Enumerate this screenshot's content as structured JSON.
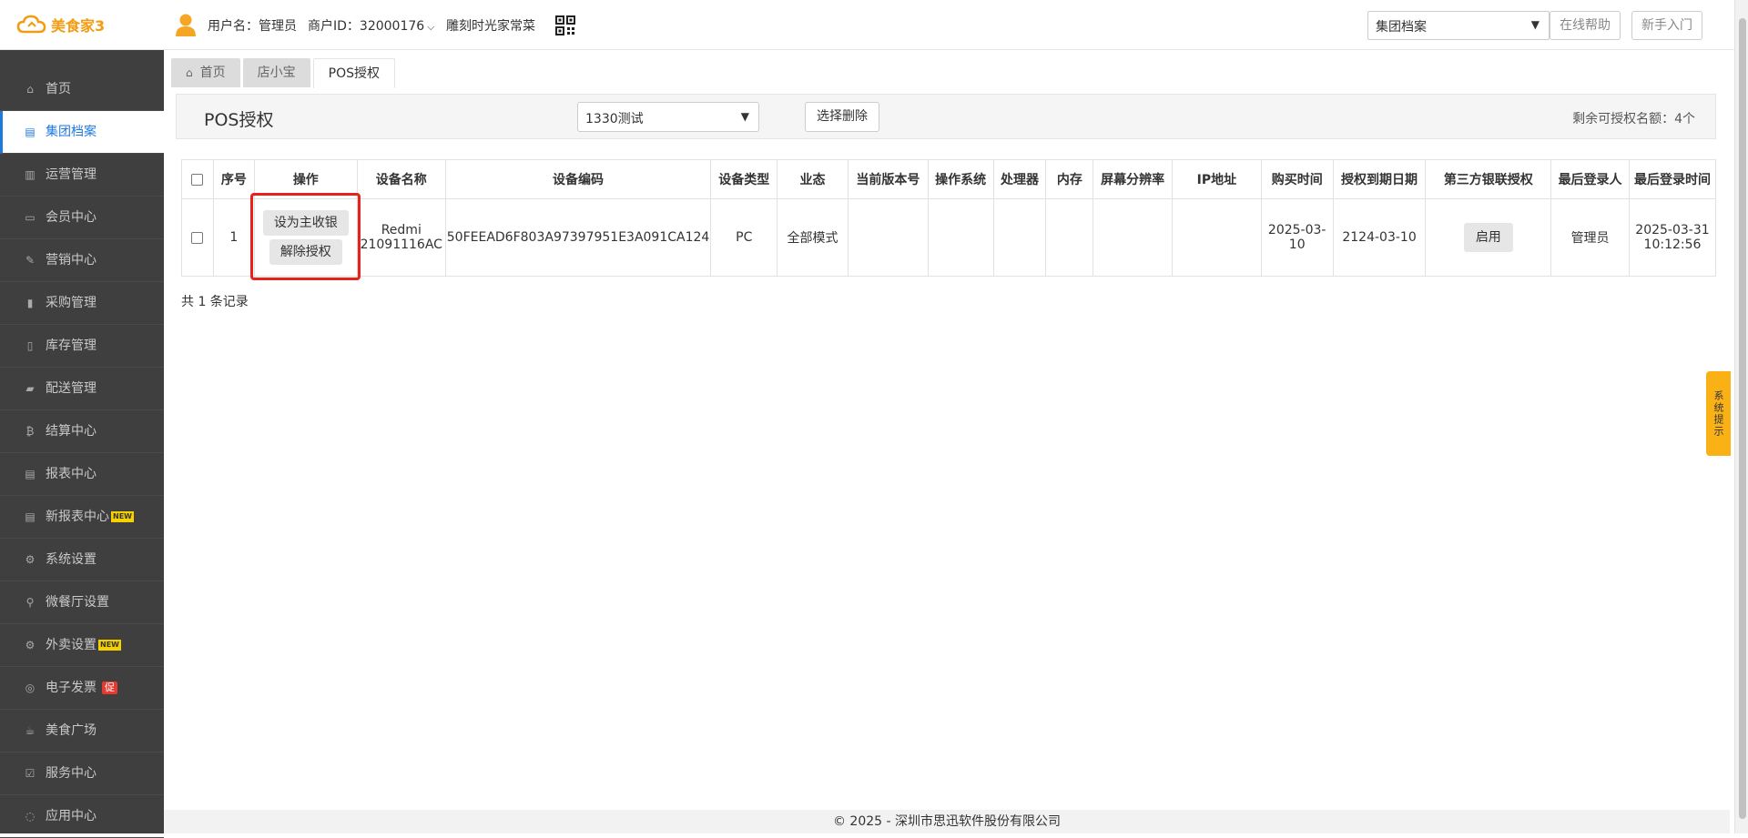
{
  "header": {
    "logo_text": "美食家3",
    "username": "用户名：管理员",
    "merchant_id": "商户ID：32000176",
    "merchant_chevron": "⌵",
    "brand": "雕刻时光家常菜",
    "group_select": "集团档案",
    "help_button": "在线帮助",
    "newbie_button": "新手入门"
  },
  "sidebar": {
    "items": [
      {
        "label": "首页",
        "icon": "home-icon",
        "glyph": "⌂"
      },
      {
        "label": "集团档案",
        "icon": "file-icon",
        "glyph": "▤"
      },
      {
        "label": "运营管理",
        "icon": "chart-icon",
        "glyph": "▥"
      },
      {
        "label": "会员中心",
        "icon": "id-card-icon",
        "glyph": "▭"
      },
      {
        "label": "营销中心",
        "icon": "edit-icon",
        "glyph": "✎"
      },
      {
        "label": "采购管理",
        "icon": "book-icon",
        "glyph": "▮"
      },
      {
        "label": "库存管理",
        "icon": "box-icon",
        "glyph": "▯"
      },
      {
        "label": "配送管理",
        "icon": "truck-icon",
        "glyph": "▰"
      },
      {
        "label": "结算中心",
        "icon": "bitcoin-icon",
        "glyph": "₿"
      },
      {
        "label": "报表中心",
        "icon": "report-icon",
        "glyph": "▤"
      },
      {
        "label": "新报表中心",
        "icon": "report-icon",
        "glyph": "▤",
        "badge": "NEW"
      },
      {
        "label": "系统设置",
        "icon": "cogs-icon",
        "glyph": "⚙"
      },
      {
        "label": "微餐厅设置",
        "icon": "cutlery-icon",
        "glyph": "⚲"
      },
      {
        "label": "外卖设置",
        "icon": "gear-icon",
        "glyph": "⚙",
        "badge": "NEW"
      },
      {
        "label": "电子发票",
        "icon": "invoice-icon",
        "glyph": "◎",
        "promo": "促"
      },
      {
        "label": "美食广场",
        "icon": "food-icon",
        "glyph": "☕"
      },
      {
        "label": "服务中心",
        "icon": "service-icon",
        "glyph": "☑"
      },
      {
        "label": "应用中心",
        "icon": "app-icon",
        "glyph": "◌"
      }
    ]
  },
  "tabs": [
    {
      "label": "首页",
      "icon": "home-icon",
      "glyph": "⌂"
    },
    {
      "label": "店小宝"
    },
    {
      "label": "POS授权"
    }
  ],
  "toolbar": {
    "title": "POS授权",
    "store_select": "1330测试",
    "delete_button": "选择删除",
    "quota": "剩余可授权名额：4个"
  },
  "table": {
    "headers": [
      "序号",
      "操作",
      "设备名称",
      "设备编码",
      "设备类型",
      "业态",
      "当前版本号",
      "操作系统",
      "处理器",
      "内存",
      "屏幕分辨率",
      "IP地址",
      "购买时间",
      "授权到期日期",
      "第三方银联授权",
      "最后登录人",
      "最后登录时间"
    ],
    "rows": [
      {
        "index": "1",
        "op_set_main": "设为主收银",
        "op_revoke": "解除授权",
        "device_name": "Redmi 21091116AC",
        "device_code": "50FEEAD6F803A97397951E3A091CA124",
        "device_type": "PC",
        "business": "全部模式",
        "version": "",
        "os": "",
        "cpu": "",
        "memory": "",
        "resolution": "",
        "ip": "",
        "purchase_time": "2025-03-10",
        "expire_date": "2124-03-10",
        "unionpay_button": "启用",
        "last_login_user": "管理员",
        "last_login_time": "2025-03-31 10:12:56"
      }
    ],
    "total": "共 1 条记录"
  },
  "footer": "© 2025 - 深圳市思迅软件股份有限公司",
  "side_tip": "系统提示",
  "colors": {
    "sidebar_bg": "#3f3f3f",
    "active_blue": "#1f7ae0",
    "brand_orange": "#f39c12",
    "highlight_red": "#e8221b",
    "tip_yellow": "#f9b115"
  }
}
